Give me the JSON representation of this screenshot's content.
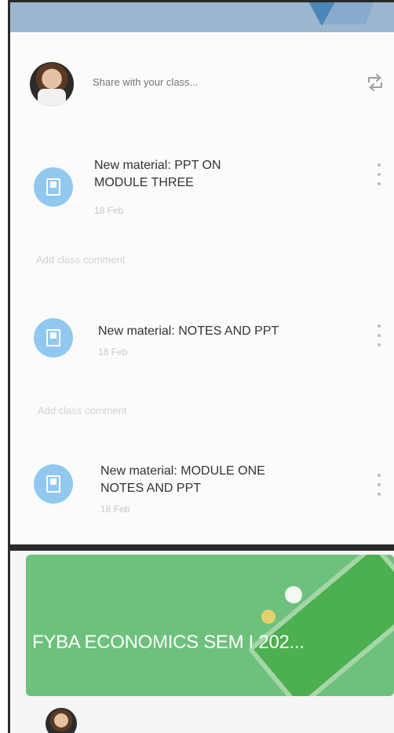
{
  "stream": {
    "share_placeholder": "Share with your class...",
    "add_comment_label": "Add class comment",
    "posts": [
      {
        "title_line1": "New material: PPT ON",
        "title_line2": "MODULE THREE",
        "date": "18 Feb"
      },
      {
        "title_line1": "New material: NOTES AND PPT",
        "title_line2": "",
        "date": "18 Feb"
      },
      {
        "title_line1": "New material: MODULE ONE",
        "title_line2": "NOTES AND PPT",
        "date": "18 Feb"
      }
    ]
  },
  "class_card": {
    "title": "FYBA ECONOMICS SEM I 202..."
  },
  "icons": {
    "avatar": "user-avatar",
    "repost": "repost-icon",
    "material": "material-doc-icon",
    "more": "more-vert-icon"
  },
  "colors": {
    "material_circle": "#90c8f0",
    "class_card": "#6ec17c"
  }
}
